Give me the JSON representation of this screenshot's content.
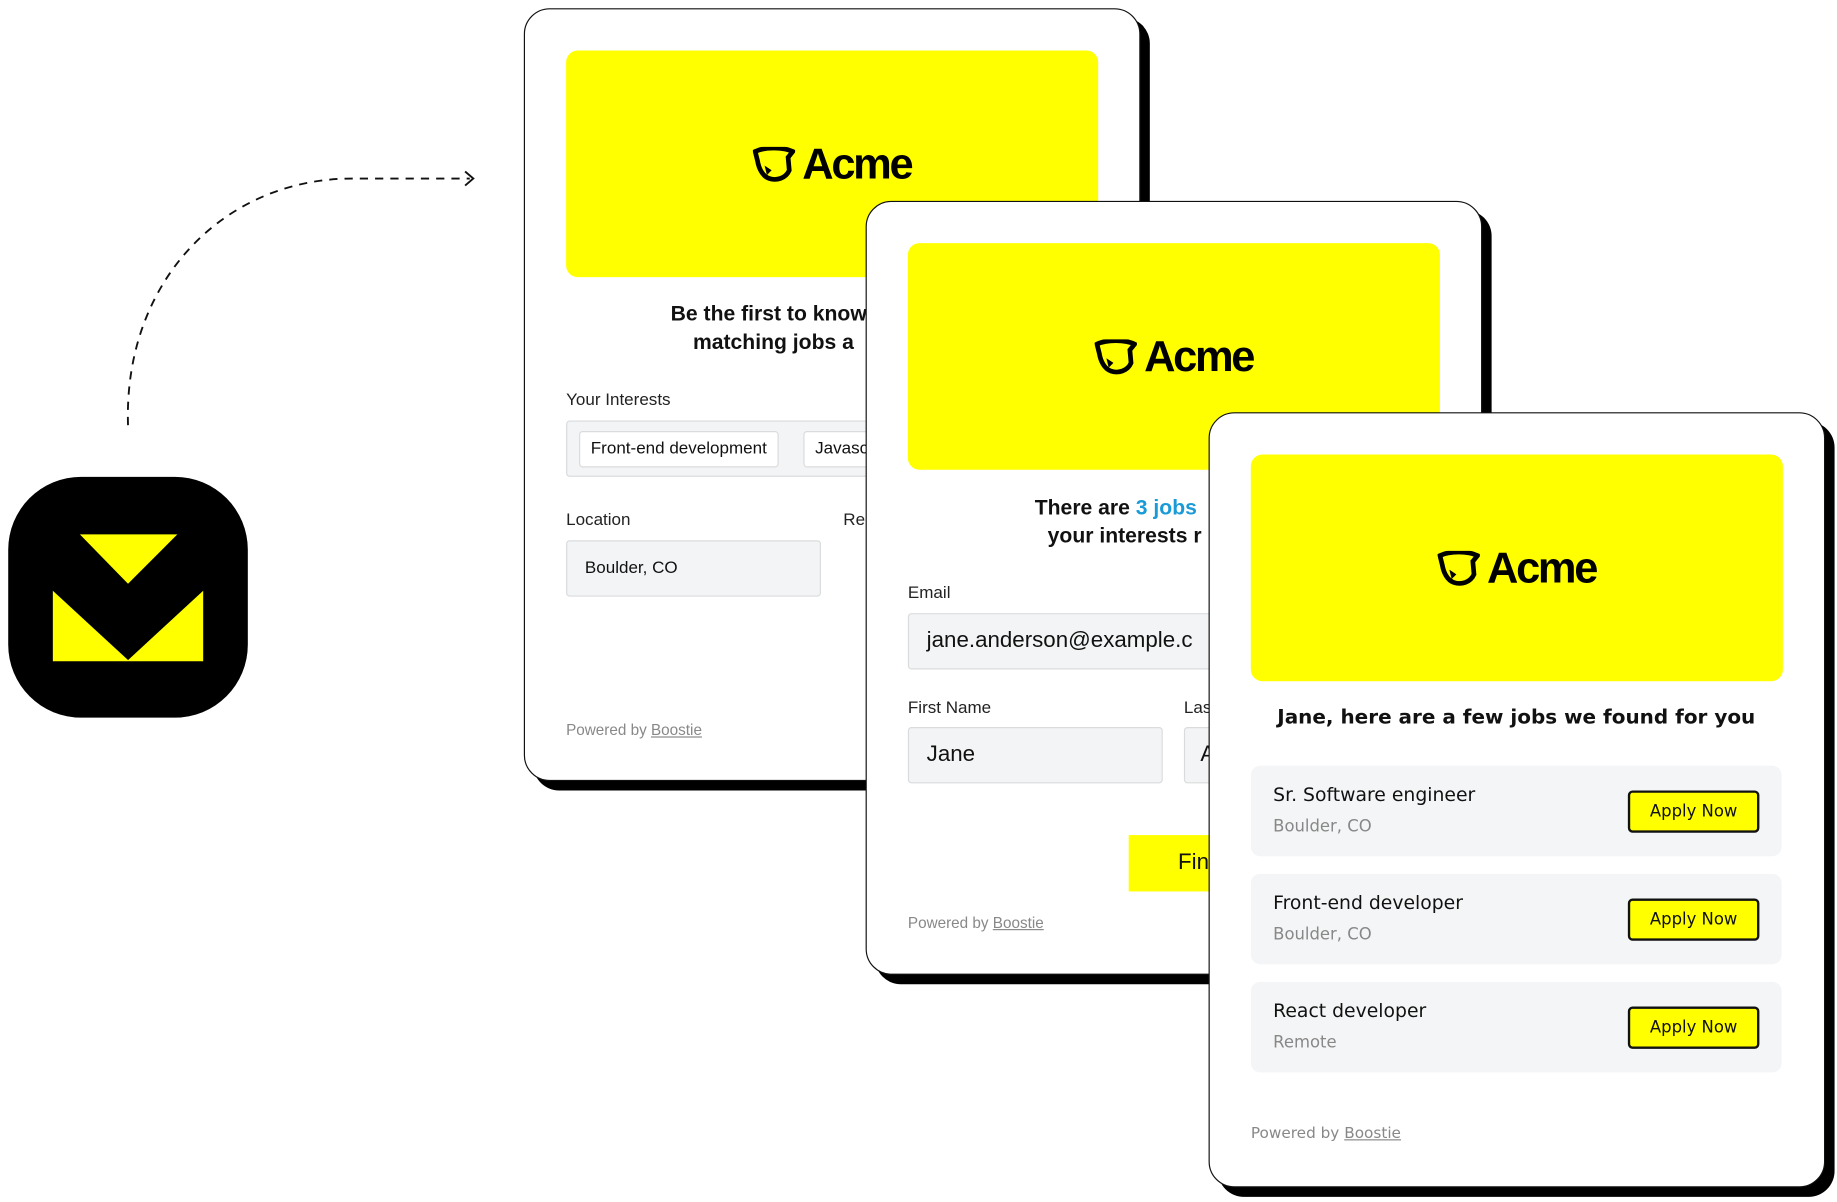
{
  "colors": {
    "brand_yellow": "#FFFF00",
    "link_blue": "#1a9bd7",
    "ink": "#000000"
  },
  "app_icon": {
    "name": "boostie-app-icon"
  },
  "brand": {
    "logo_text": "Acme",
    "logo_icon": "bull-head-icon"
  },
  "card1": {
    "heading_line1": "Be the first to know",
    "heading_line2": "matching jobs a",
    "interests_label": "Your Interests",
    "tags": [
      "Front-end development",
      "Javasc"
    ],
    "location_label": "Location",
    "location_value": "Boulder, CO",
    "remote_label_partial": "Re",
    "powered_prefix": "Powered by",
    "powered_link": "Boostie"
  },
  "card2": {
    "heading_prefix": "There are ",
    "heading_highlight": "3 jobs",
    "heading_line2": "your interests r",
    "email_label": "Email",
    "email_value": "jane.anderson@example.c",
    "first_name_label": "First Name",
    "first_name_value": "Jane",
    "last_name_label_partial": "Las",
    "last_name_value_partial": "A",
    "submit_partial": "Fin",
    "powered_prefix": "Powered by",
    "powered_link": "Boostie"
  },
  "card3": {
    "heading": "Jane, here are a few jobs we found for you",
    "jobs": [
      {
        "title": "Sr. Software engineer",
        "location": "Boulder, CO",
        "button": "Apply Now"
      },
      {
        "title": "Front-end developer",
        "location": "Boulder, CO",
        "button": "Apply Now"
      },
      {
        "title": "React developer",
        "location": "Remote",
        "button": "Apply Now"
      }
    ],
    "powered_prefix": "Powered by",
    "powered_link": "Boostie"
  }
}
